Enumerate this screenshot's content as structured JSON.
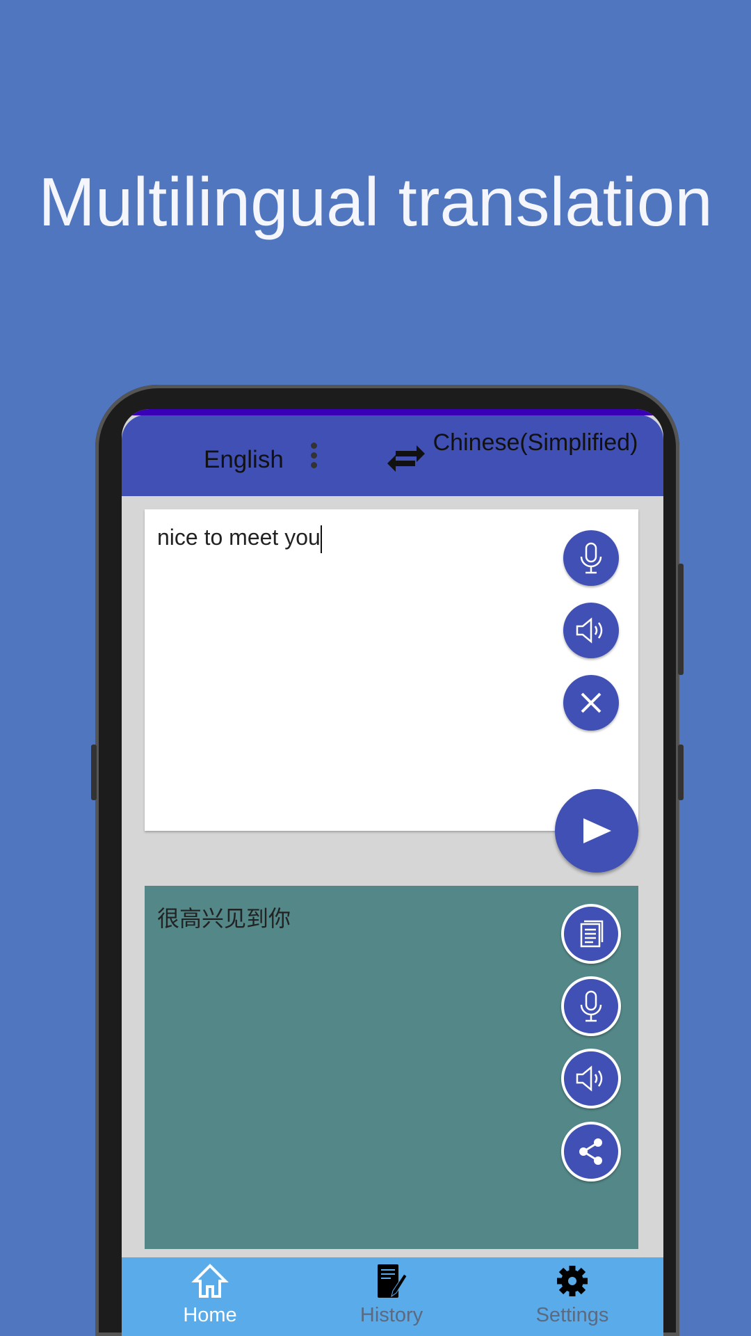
{
  "banner": {
    "title": "Multilingual translation"
  },
  "header": {
    "source_language": "English",
    "target_language": "Chinese(Simplified)"
  },
  "input": {
    "text": "nice to meet you"
  },
  "output": {
    "text": "很高兴见到你"
  },
  "nav": {
    "items": [
      {
        "label": "Home",
        "icon": "home-icon",
        "active": true
      },
      {
        "label": "History",
        "icon": "history-icon",
        "active": false
      },
      {
        "label": "Settings",
        "icon": "gear-icon",
        "active": false
      }
    ]
  },
  "colors": {
    "background": "#4f76bf",
    "header": "#4150b5",
    "output_card": "#548888",
    "nav": "#5aabea"
  }
}
